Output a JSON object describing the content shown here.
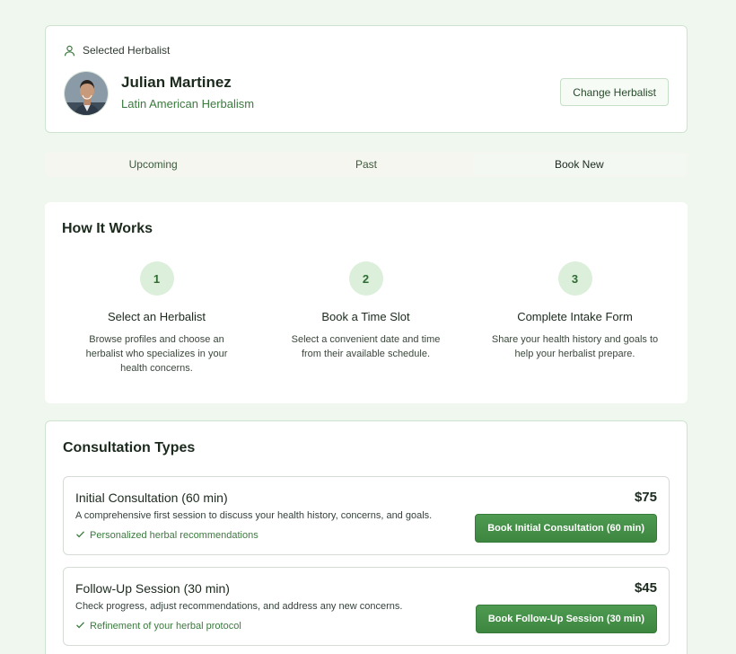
{
  "herbalist": {
    "section_label": "Selected Herbalist",
    "name": "Julian Martinez",
    "specialty": "Latin American Herbalism",
    "change_label": "Change Herbalist"
  },
  "tabs": [
    {
      "label": "Upcoming",
      "active": false
    },
    {
      "label": "Past",
      "active": false
    },
    {
      "label": "Book New",
      "active": true
    }
  ],
  "how_it_works": {
    "title": "How It Works",
    "steps": [
      {
        "number": "1",
        "title": "Select an Herbalist",
        "description": "Browse profiles and choose an herbalist who specializes in your health concerns."
      },
      {
        "number": "2",
        "title": "Book a Time Slot",
        "description": "Select a convenient date and time from their available schedule."
      },
      {
        "number": "3",
        "title": "Complete Intake Form",
        "description": "Share your health history and goals to help your herbalist prepare."
      }
    ]
  },
  "consultation_types": {
    "title": "Consultation Types",
    "items": [
      {
        "name": "Initial Consultation (60 min)",
        "description": "A comprehensive first session to discuss your health history, concerns, and goals.",
        "feature": "Personalized herbal recommendations",
        "price": "$75",
        "button_label": "Book Initial Consultation (60 min)"
      },
      {
        "name": "Follow-Up Session (30 min)",
        "description": "Check progress, adjust recommendations, and address any new concerns.",
        "feature": "Refinement of your herbal protocol",
        "price": "$45",
        "button_label": "Book Follow-Up Session (30 min)"
      }
    ]
  },
  "icons": {
    "section_label_icon": "user-icon",
    "feature_icon": "check-icon"
  },
  "colors": {
    "page_background": "#f0f7ef",
    "accent_green": "#3d8640",
    "specialty_text": "#3b7a3e",
    "step_circle": "#dcefdb"
  }
}
